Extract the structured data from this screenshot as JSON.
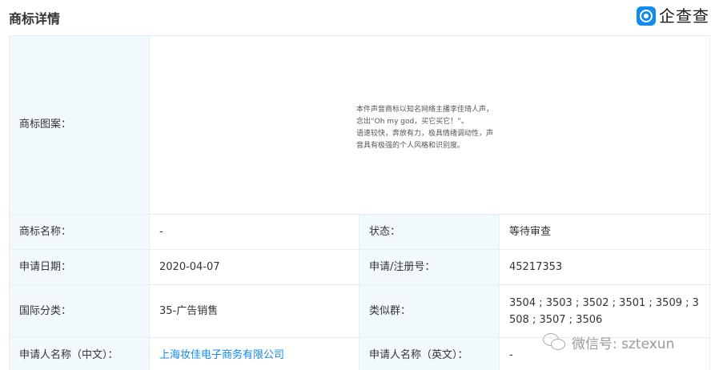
{
  "header": {
    "title": "商标详情",
    "logo_text": "企查查",
    "logo_color": "#128bed"
  },
  "trademark_image": {
    "label": "商标图案：",
    "lines": [
      "本件声音商标以知名网络主播李佳琦人声，",
      "念出“Oh my god，买它买它！”。",
      "语速较快，奔放有力，极具情绪调动性，声",
      "音具有极强的个人风格和识别度。"
    ]
  },
  "rows": [
    {
      "label1": "商标名称：",
      "value1": "-",
      "label2": "状态：",
      "value2": "等待审查"
    },
    {
      "label1": "申请日期：",
      "value1": "2020-04-07",
      "label2": "申请/注册号：",
      "value2": "45217353"
    },
    {
      "label1": "国际分类：",
      "value1": "35-广告销售",
      "label2": "类似群：",
      "value2": "3504 ; 3503 ; 3502 ; 3501 ; 3509 ; 3508 ; 3507 ; 3506"
    },
    {
      "label1": "申请人名称（中文）：",
      "value1": "上海妆佳电子商务有限公司",
      "label2": "申请人名称（英文）：",
      "value2": "-"
    }
  ],
  "watermark": {
    "text": "微信号: sztexun"
  },
  "colors": {
    "label_bg": "#f2f9fc",
    "border": "#e4eef6",
    "link": "#128bed"
  }
}
